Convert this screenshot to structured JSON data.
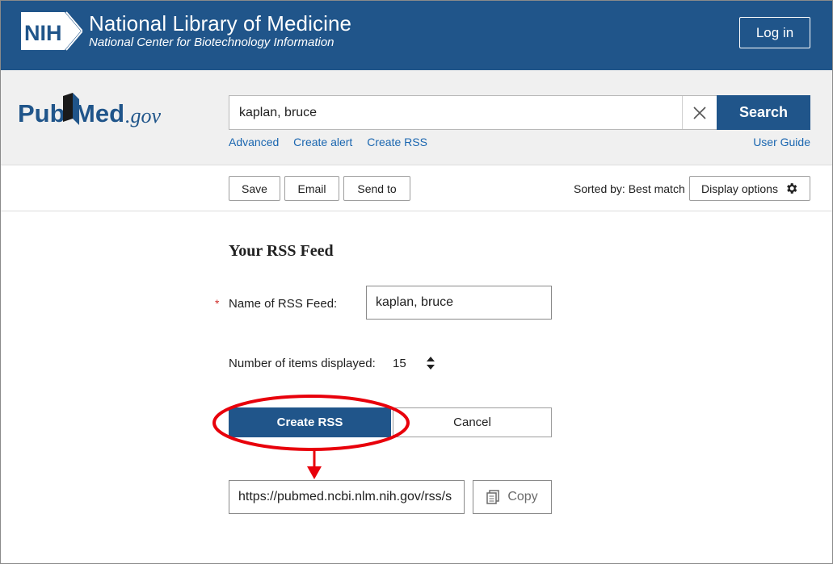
{
  "header": {
    "logo_text": "NIH",
    "title": "National Library of Medicine",
    "subtitle": "National Center for Biotechnology Information",
    "login_label": "Log in"
  },
  "search": {
    "brand_prefix": "Pub",
    "brand_suffix": "Med",
    "brand_domain": ".gov",
    "query": "kaplan, bruce",
    "button_label": "Search",
    "links": [
      "Advanced",
      "Create alert",
      "Create RSS"
    ],
    "user_guide": "User Guide"
  },
  "toolbar": {
    "save_label": "Save",
    "email_label": "Email",
    "send_to_label": "Send to",
    "sorted_by": "Sorted by: Best match",
    "display_options_label": "Display options"
  },
  "rss_form": {
    "title": "Your RSS Feed",
    "required_marker": "*",
    "name_label": "Name of RSS Feed:",
    "name_value": "kaplan, bruce",
    "items_label": "Number of items displayed:",
    "items_value": "15",
    "create_label": "Create RSS",
    "cancel_label": "Cancel",
    "feed_url": "https://pubmed.ncbi.nlm.nih.gov/rss/s",
    "copy_label": "Copy"
  },
  "colors": {
    "brand_blue": "#20558a",
    "link_blue": "#1a66b0",
    "annotation_red": "#e8000b"
  }
}
